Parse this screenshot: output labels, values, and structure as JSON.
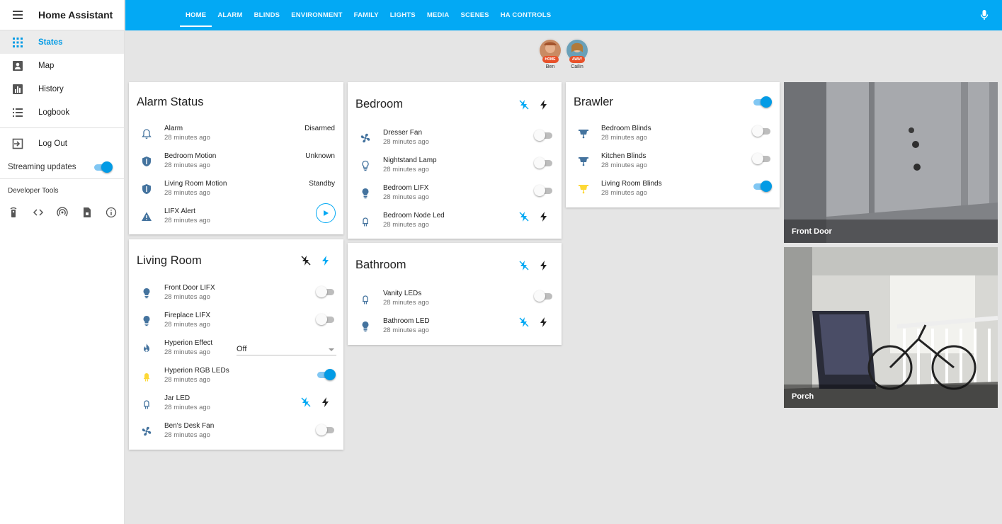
{
  "app": {
    "title": "Home Assistant"
  },
  "sidebar": {
    "items": [
      {
        "label": "States",
        "icon": "grid-icon",
        "active": true
      },
      {
        "label": "Map",
        "icon": "map-icon"
      },
      {
        "label": "History",
        "icon": "history-chart-icon"
      },
      {
        "label": "Logbook",
        "icon": "logbook-list-icon"
      },
      {
        "label": "Log Out",
        "icon": "exit-icon"
      }
    ],
    "streaming_label": "Streaming updates",
    "streaming_on": true,
    "dev_tools_title": "Developer Tools",
    "dev_tools": [
      "remote-icon",
      "code-icon",
      "wifi-tethering-icon",
      "file-template-icon",
      "info-icon"
    ]
  },
  "topbar": {
    "tabs": [
      "HOME",
      "ALARM",
      "BLINDS",
      "ENVIRONMENT",
      "FAMILY",
      "LIGHTS",
      "MEDIA",
      "SCENES",
      "HA CONTROLS"
    ],
    "active_tab": "HOME",
    "color": "#03a9f4"
  },
  "people": [
    {
      "name": "Ben",
      "badge": "HOME"
    },
    {
      "name": "Cailin",
      "badge": "AWAY"
    }
  ],
  "cards": {
    "alarm": {
      "title": "Alarm Status",
      "rows": [
        {
          "name": "Alarm",
          "time": "28 minutes ago",
          "state": "Disarmed"
        },
        {
          "name": "Bedroom Motion",
          "time": "28 minutes ago",
          "state": "Unknown"
        },
        {
          "name": "Living Room Motion",
          "time": "28 minutes ago",
          "state": "Standby"
        },
        {
          "name": "LIFX Alert",
          "time": "28 minutes ago"
        }
      ]
    },
    "living": {
      "title": "Living Room",
      "rows": [
        {
          "name": "Front Door LIFX",
          "time": "28 minutes ago",
          "on": false
        },
        {
          "name": "Fireplace LIFX",
          "time": "28 minutes ago",
          "on": false
        },
        {
          "name": "Hyperion Effect",
          "time": "28 minutes ago",
          "select": "Off"
        },
        {
          "name": "Hyperion RGB LEDs",
          "time": "28 minutes ago",
          "on": true
        },
        {
          "name": "Jar LED",
          "time": "28 minutes ago"
        },
        {
          "name": "Ben's Desk Fan",
          "time": "28 minutes ago",
          "on": false
        }
      ]
    },
    "bedroom": {
      "title": "Bedroom",
      "rows": [
        {
          "name": "Dresser Fan",
          "time": "28 minutes ago",
          "on": false
        },
        {
          "name": "Nightstand Lamp",
          "time": "28 minutes ago",
          "on": false
        },
        {
          "name": "Bedroom LIFX",
          "time": "28 minutes ago",
          "on": false
        },
        {
          "name": "Bedroom Node Led",
          "time": "28 minutes ago"
        }
      ]
    },
    "bathroom": {
      "title": "Bathroom",
      "rows": [
        {
          "name": "Vanity LEDs",
          "time": "28 minutes ago",
          "on": false
        },
        {
          "name": "Bathroom LED",
          "time": "28 minutes ago"
        }
      ]
    },
    "brawler": {
      "title": "Brawler",
      "on": true,
      "rows": [
        {
          "name": "Bedroom Blinds",
          "time": "28 minutes ago",
          "on": false
        },
        {
          "name": "Kitchen Blinds",
          "time": "28 minutes ago",
          "on": false
        },
        {
          "name": "Living Room Blinds",
          "time": "28 minutes ago",
          "on": true
        }
      ]
    }
  },
  "cameras": [
    {
      "name": "Front Door"
    },
    {
      "name": "Porch"
    }
  ],
  "colors": {
    "accent": "#03a9f4",
    "icon": "#44739e",
    "active_icon": "#fdd835",
    "badge": "#e8512a"
  }
}
